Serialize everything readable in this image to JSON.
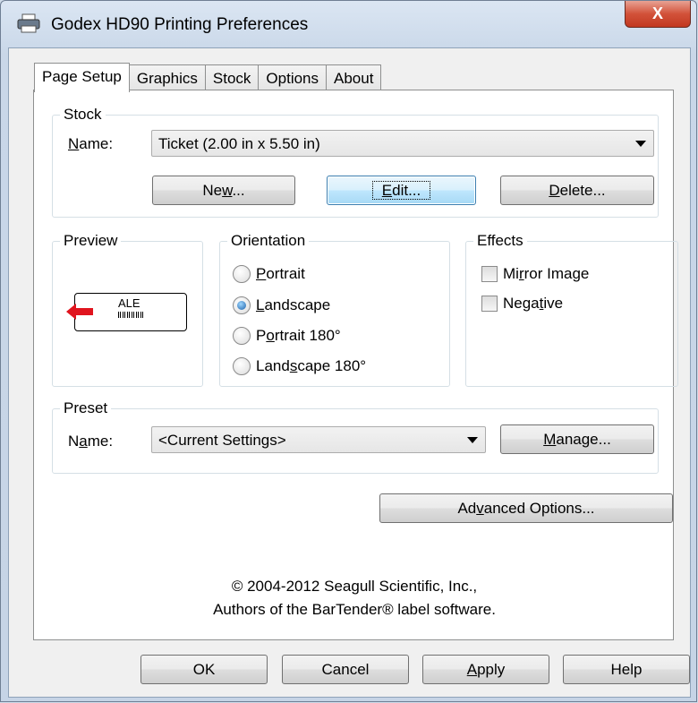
{
  "window": {
    "title": "Godex HD90 Printing Preferences",
    "close_glyph": "X"
  },
  "tabs": [
    {
      "label": "Page Setup",
      "active": true
    },
    {
      "label": "Graphics"
    },
    {
      "label": "Stock"
    },
    {
      "label": "Options"
    },
    {
      "label": "About"
    }
  ],
  "stock": {
    "group_label": "Stock",
    "name_label_pre": "",
    "name_label_u": "N",
    "name_label_post": "ame:",
    "name_value": "Ticket (2.00 in x 5.50 in)",
    "new_pre": "Ne",
    "new_u": "w",
    "new_post": "...",
    "edit_pre": "",
    "edit_u": "E",
    "edit_post": "dit...",
    "delete_pre": "",
    "delete_u": "D",
    "delete_post": "elete..."
  },
  "preview": {
    "group_label": "Preview",
    "label_text": "ALE"
  },
  "orientation": {
    "group_label": "Orientation",
    "options": [
      {
        "pre": "",
        "u": "P",
        "post": "ortrait",
        "selected": false
      },
      {
        "pre": "",
        "u": "L",
        "post": "andscape",
        "selected": true
      },
      {
        "pre": "P",
        "u": "o",
        "post": "rtrait 180°",
        "selected": false
      },
      {
        "pre": "Land",
        "u": "s",
        "post": "cape 180°",
        "selected": false
      }
    ]
  },
  "effects": {
    "group_label": "Effects",
    "mirror_pre": "Mi",
    "mirror_u": "r",
    "mirror_post": "ror Image",
    "negative_pre": "Nega",
    "negative_u": "t",
    "negative_post": "ive"
  },
  "preset": {
    "group_label": "Preset",
    "name_label_pre": "N",
    "name_label_u": "a",
    "name_label_post": "me:",
    "name_value": "<Current Settings>",
    "manage_pre": "",
    "manage_u": "M",
    "manage_post": "anage..."
  },
  "advanced": {
    "pre": "Ad",
    "u": "v",
    "post": "anced Options..."
  },
  "copyright": {
    "line1": "© 2004-2012 Seagull Scientific, Inc.,",
    "line2": "Authors of the BarTender® label software."
  },
  "footer": {
    "ok": "OK",
    "cancel": "Cancel",
    "apply_pre": "",
    "apply_u": "A",
    "apply_post": "pply",
    "help": "Help"
  },
  "colors": {
    "accent": "#1a5fa8",
    "arrow": "#e0141e",
    "close": "#c23820"
  }
}
